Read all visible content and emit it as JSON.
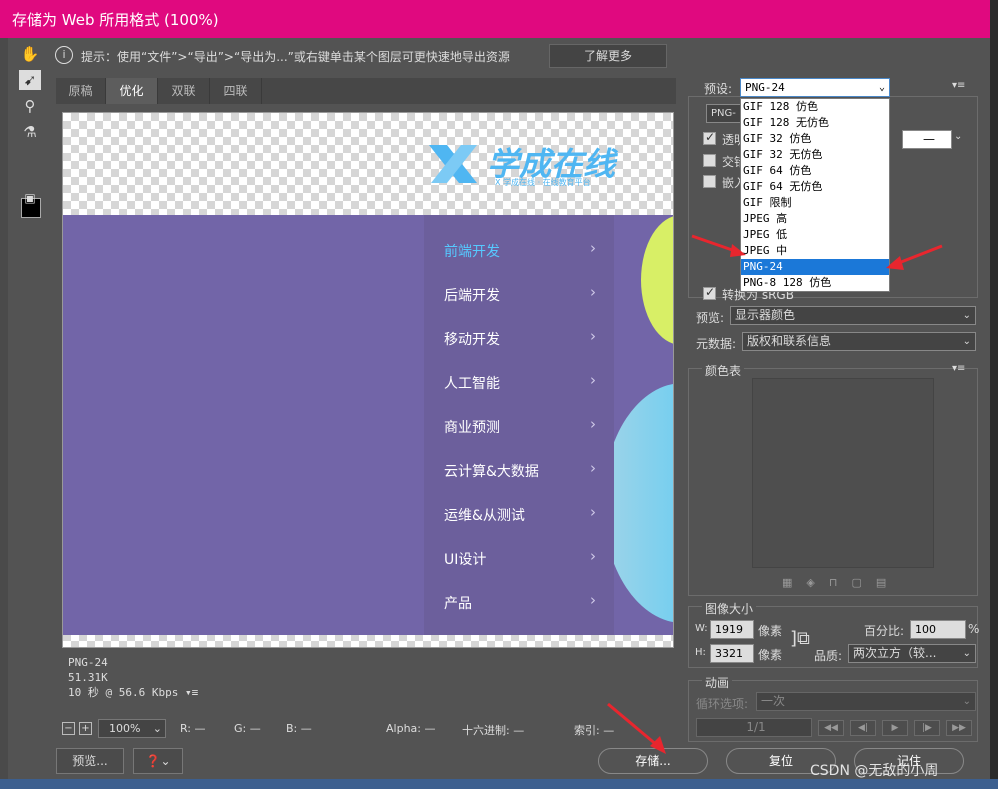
{
  "window": {
    "title": "存储为 Web 所用格式 (100%)"
  },
  "tip": {
    "icon": "info-icon",
    "text": "提示：使用“文件”>“导出”>“导出为...”或右键单击某个图层可更快速地导出资源",
    "learn_more": "了解更多"
  },
  "tabs": [
    "原稿",
    "优化",
    "双联",
    "四联"
  ],
  "active_tab": "优化",
  "preview": {
    "logo_text": "学成在线",
    "logo_sub": "X 学成在线 · 在线教育平台",
    "menu": [
      "前端开发",
      "后端开发",
      "移动开发",
      "人工智能",
      "商业预测",
      "云计算&大数据",
      "运维&从测试",
      "UI设计",
      "产品"
    ],
    "chevron": "›"
  },
  "image_info": {
    "format": "PNG-24",
    "size": "51.31K",
    "speed": "10 秒 @ 56.6 Kbps"
  },
  "status": {
    "zoom": "100%",
    "r": "R: —",
    "g": "G: —",
    "b": "B: —",
    "alpha": "Alpha: —",
    "hex": "十六进制: —",
    "index": "索引: —"
  },
  "buttons": {
    "preview": "预览...",
    "save": "存储...",
    "reset": "复位",
    "remember": "记住"
  },
  "settings": {
    "preset_label": "预设:",
    "preset_value": "PNG-24",
    "format_value": "PNG-",
    "transparency_label": "透明",
    "interlaced_label": "交错",
    "embed_label": "嵌入",
    "matte_value": "—",
    "convert_label": "转换为 sRGB",
    "preview_label": "预览:",
    "preview_value": "显示器颜色",
    "metadata_label": "元数据:",
    "metadata_value": "版权和联系信息"
  },
  "preset_options": [
    "GIF 128 仿色",
    "GIF 128 无仿色",
    "GIF 32 仿色",
    "GIF 32 无仿色",
    "GIF 64 仿色",
    "GIF 64 无仿色",
    "GIF 限制",
    "JPEG 高",
    "JPEG 低",
    "JPEG 中",
    "PNG-24",
    "PNG-8 128 仿色"
  ],
  "selected_preset": "PNG-24",
  "color_table": {
    "title": "颜色表"
  },
  "image_size": {
    "title": "图像大小",
    "w_label": "W:",
    "w": "1919",
    "h_label": "H:",
    "h": "3321",
    "unit": "像素",
    "percent_label": "百分比:",
    "percent": "100",
    "percent_unit": "%",
    "quality_label": "品质:",
    "quality": "两次立方（较..."
  },
  "animation": {
    "title": "动画",
    "loop_label": "循环选项:",
    "loop_value": "一次",
    "frame": "1/1"
  },
  "watermark": "CSDN @无敌的小周"
}
